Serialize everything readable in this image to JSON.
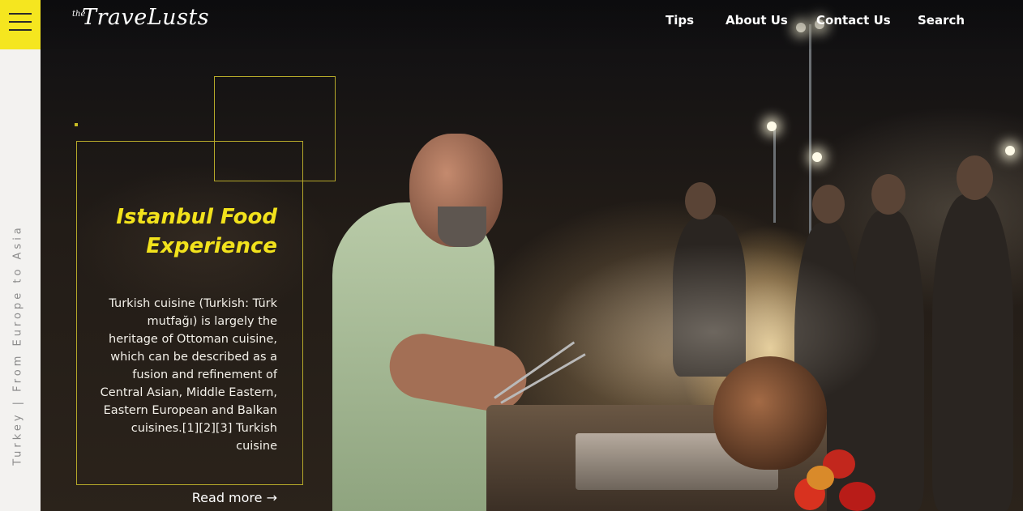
{
  "header": {
    "logo_prefix": "the",
    "logo_name": "TraveLusts",
    "nav": [
      "Tips",
      "About Us",
      "Contact Us",
      "Search"
    ]
  },
  "sidebar": {
    "caption": "Turkey | From Europe to Asia"
  },
  "hero": {
    "title_line1": "Istanbul Food",
    "title_line2": "Experience",
    "description": "Turkish cuisine (Turkish: Türk mutfağı) is largely the heritage of Ottoman cuisine, which can be described as a fusion and refinement of Central Asian, Middle Eastern, Eastern European and Balkan cuisines.[1][2][3] Turkish cuisine",
    "read_more": "Read more →"
  },
  "colors": {
    "accent": "#f5e61f",
    "frame": "#b5a82a",
    "rail": "#f3f2f0"
  },
  "icons": {
    "menu": "hamburger-icon"
  }
}
